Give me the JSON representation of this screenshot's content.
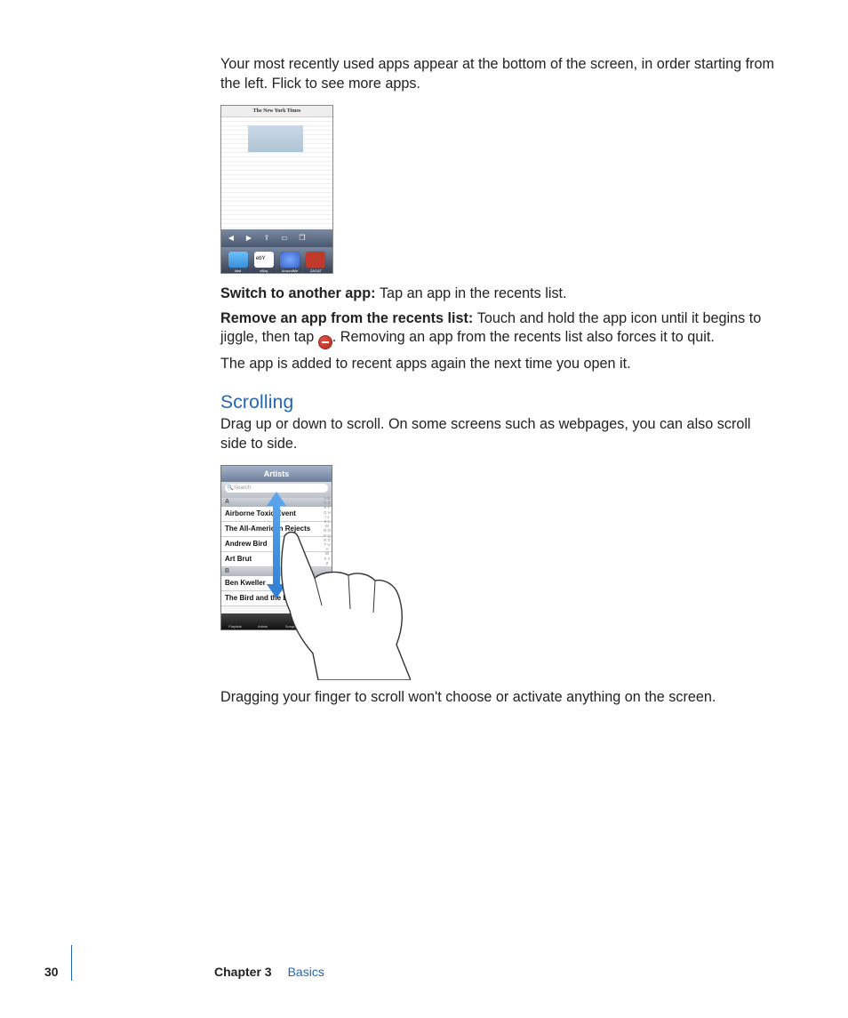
{
  "intro": "Your most recently used apps appear at the bottom of the screen, in order starting from the left. Flick to see more apps.",
  "fig1": {
    "masthead": "The New York Times",
    "dockApps": [
      "Mail",
      "eBay",
      "AroundMe",
      "ZAGAT"
    ]
  },
  "p1": {
    "bold": "Switch to another app:  ",
    "text": "Tap an app in the recents list."
  },
  "p2": {
    "bold": "Remove an app from the recents list:  ",
    "textA": "Touch and hold the app icon until it begins to jiggle, then tap ",
    "textB": ". Removing an app from the recents list also forces it to quit."
  },
  "p3": "The app is added to recent apps again the next time you open it.",
  "h2": "Scrolling",
  "p4": "Drag up or down to scroll. On some screens such as webpages, you can also scroll side to side.",
  "fig2": {
    "title": "Artists",
    "searchPlaceholder": "Search",
    "sectA": "A",
    "rows": [
      "Airborne Toxic Event",
      "The All-American Rejects",
      "Andrew Bird",
      "Art Brut"
    ],
    "sectB": "B",
    "rowsB": [
      "Ben Kweller",
      "The Bird and the Bee"
    ],
    "indexLetters": "A\nB\nC\nD\nE\nF\nG\nH\nI\nJ\nK\nL\nM\nN\nO\nP\nQ\nR\nS\nT\nU\nV\nW\nX\nY\nZ"
  },
  "p5": "Dragging your finger to scroll won't choose or activate anything on the screen.",
  "footer": {
    "page": "30",
    "chapter": "Chapter 3",
    "name": "Basics"
  }
}
